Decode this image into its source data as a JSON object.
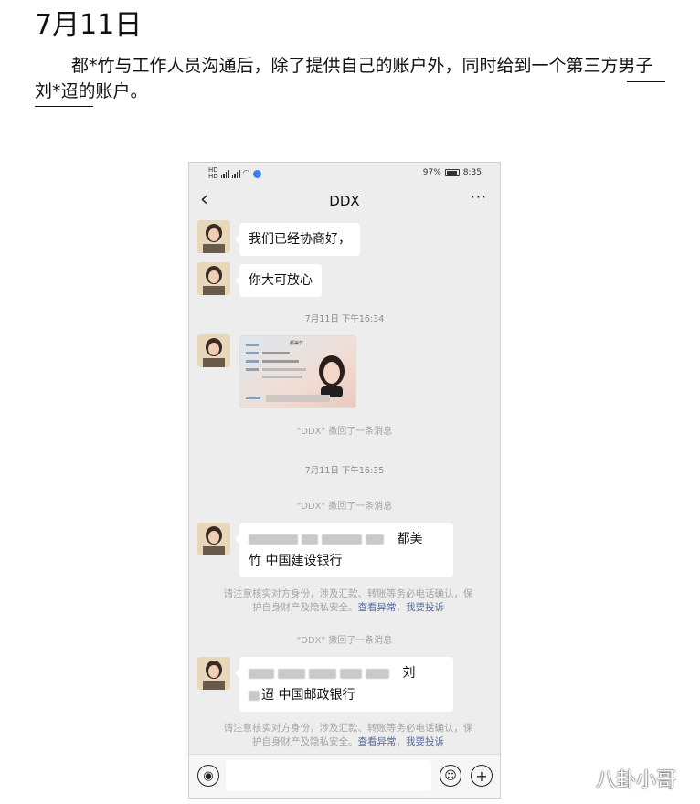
{
  "document": {
    "date": "7月11日",
    "paragraph": "都*竹与工作人员沟通后，除了提供自己的账户外，同时给到一个第三方男子刘*迢的账户。"
  },
  "status_bar": {
    "battery": "97%",
    "time": "8:35"
  },
  "chat": {
    "title": "DDX",
    "back_icon": "chevron-left-icon",
    "more_icon": "more-icon",
    "messages": [
      {
        "type": "text",
        "text": "我们已经协商好，"
      },
      {
        "type": "text",
        "text": "你大可放心"
      },
      {
        "type": "time",
        "text": "7月11日 下午16:34"
      },
      {
        "type": "image",
        "label": "身份证照片",
        "card_name": "都美竹"
      },
      {
        "type": "system",
        "text": "\"DDX\" 撤回了一条消息"
      },
      {
        "type": "time",
        "text": "7月11日 下午16:35"
      },
      {
        "type": "system",
        "text": "\"DDX\" 撤回了一条消息"
      },
      {
        "type": "text",
        "line1_suffix": "都美",
        "line2": "竹  中国建设银行"
      },
      {
        "type": "warning",
        "text": "请注意核实对方身份，涉及汇款、转账等务必电话确认，保护自身财产及隐私安全。",
        "link1": "查看异常",
        "link2": "我要投诉"
      },
      {
        "type": "system",
        "text": "\"DDX\" 撤回了一条消息"
      },
      {
        "type": "text",
        "line1_suffix": "刘",
        "line2": "迢  中国邮政银行"
      },
      {
        "type": "warning",
        "text": "请注意核实对方身份，涉及汇款、转账等务必电话确认，保护自身财产及隐私安全。",
        "link1": "查看异常",
        "link2": "我要投诉"
      }
    ]
  },
  "input_bar": {
    "voice_icon": "voice-icon",
    "emoji_icon": "emoji-icon",
    "plus_icon": "plus-icon"
  },
  "watermark": "八卦小哥"
}
